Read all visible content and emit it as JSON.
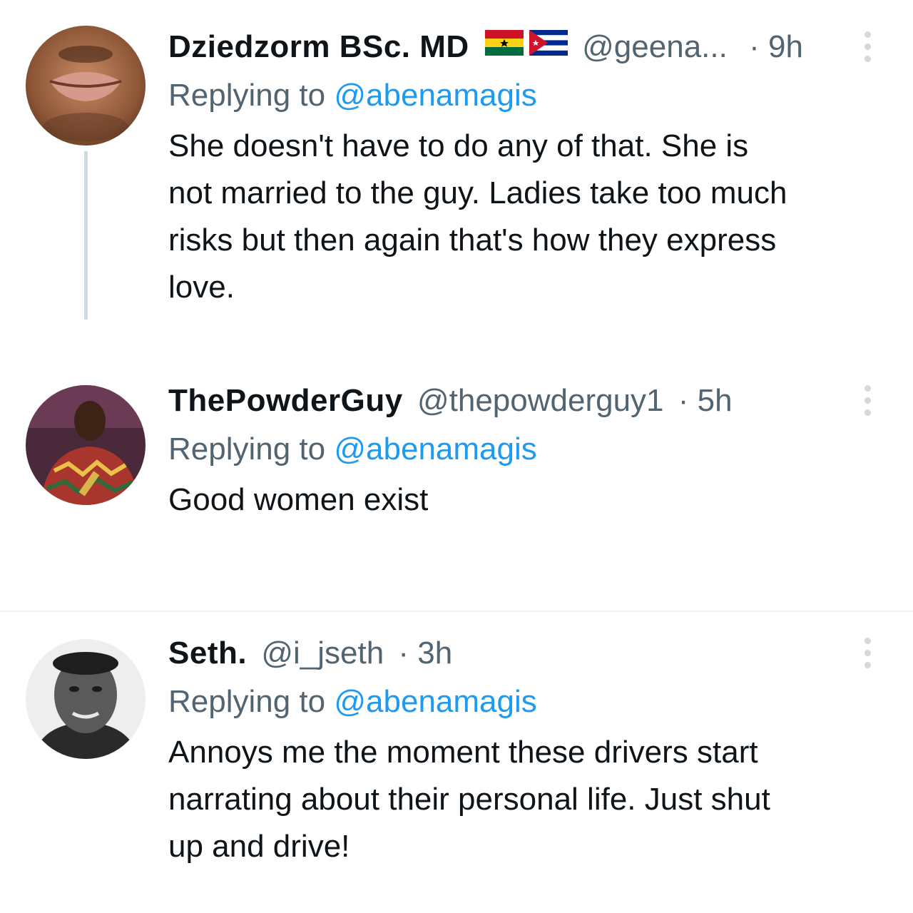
{
  "tweets": [
    {
      "name": "Dziedzorm BSc. MD",
      "handle": "@geena...",
      "time": "9h",
      "dot": "·",
      "reply_prefix": "Replying to",
      "reply_to": "@abenamagis",
      "lines": [
        "She doesn't have to do any of that. She is",
        "not married to the guy. Ladies take too much",
        "risks but then again that's how they express",
        "love."
      ],
      "flags": [
        "ghana-flag-icon",
        "cuba-flag-icon"
      ]
    },
    {
      "name": "ThePowderGuy",
      "handle": "@thepowderguy1",
      "time": "5h",
      "dot": "·",
      "reply_prefix": "Replying to",
      "reply_to": "@abenamagis",
      "lines": [
        "Good women exist"
      ]
    },
    {
      "name": "Seth.",
      "handle": "@i_jseth",
      "time": "3h",
      "dot": "·",
      "reply_prefix": "Replying to",
      "reply_to": "@abenamagis",
      "lines": [
        "Annoys me the moment these drivers start",
        "narrating about their personal life. Just shut",
        "up and drive!"
      ]
    }
  ],
  "colors": {
    "text": "#0f1419",
    "secondary": "#536471",
    "accent": "#1d9bf0",
    "divider": "#eff3f4"
  }
}
